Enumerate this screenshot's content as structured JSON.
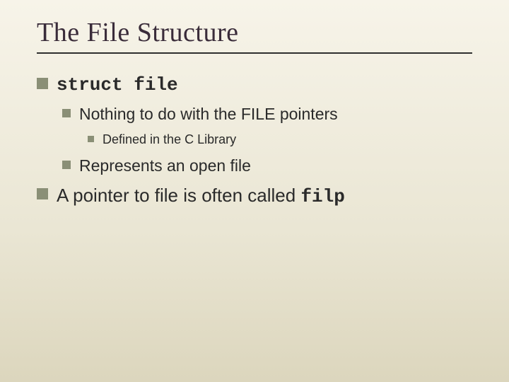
{
  "title": "The File Structure",
  "bullets": {
    "b1_code": "struct file",
    "b1a": "Nothing to do with the FILE pointers",
    "b1a1": "Defined in the C Library",
    "b1b": "Represents an open file",
    "b2_pre": "A pointer to file is often called ",
    "b2_code": "filp"
  }
}
